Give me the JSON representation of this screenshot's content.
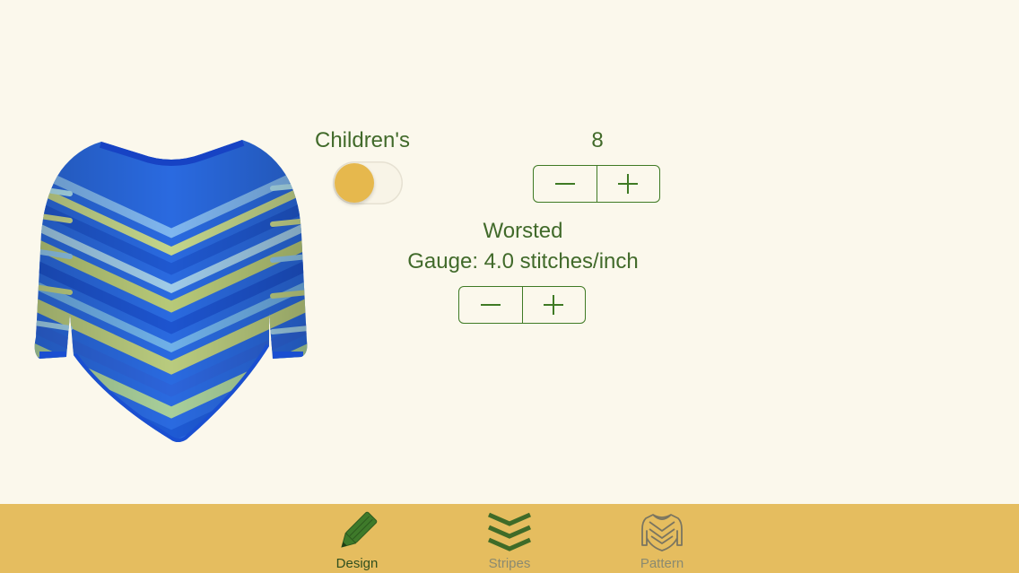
{
  "design": {
    "size_category": {
      "label": "Children's",
      "toggle_on": true
    },
    "size": {
      "value": "8"
    },
    "yarn": {
      "weight_label": "Worsted",
      "gauge_text": "Gauge: 4.0 stitches/inch"
    }
  },
  "tabbar": {
    "tabs": [
      {
        "label": "Design",
        "icon": "pencil-icon",
        "active": true
      },
      {
        "label": "Stripes",
        "icon": "chevrons-icon",
        "active": false
      },
      {
        "label": "Pattern",
        "icon": "sweater-icon",
        "active": false
      }
    ]
  },
  "colors": {
    "background": "#fbf8ec",
    "text": "#416a2a",
    "tabbar": "#e5bd5f",
    "toggle_knob": "#e6b84d",
    "sweater_blue": "#1f5fd6",
    "sweater_green": "#b7c978"
  }
}
